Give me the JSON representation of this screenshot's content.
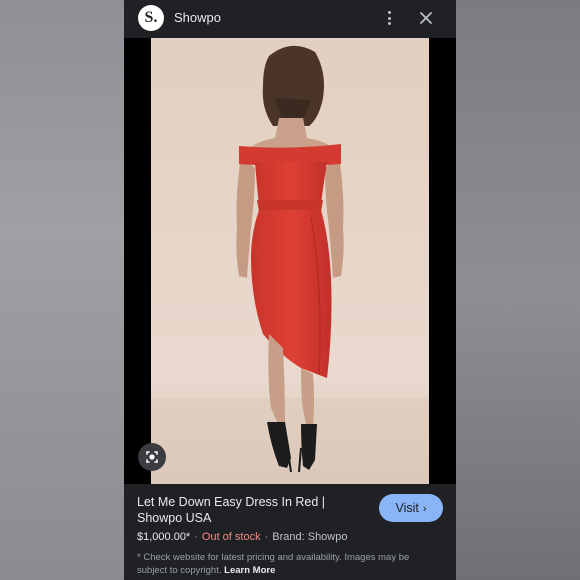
{
  "header": {
    "logo_letter": "S.",
    "site_name": "Showpo"
  },
  "image": {
    "alt": "Let Me Down Easy Dress In Red",
    "dress_color": "#d63a2f",
    "background_color": "#e6d4c7"
  },
  "product": {
    "title": "Let Me Down Easy Dress In Red | Showpo USA",
    "price": "$1,000.00*",
    "stock_status": "Out of stock",
    "brand": "Brand: Showpo",
    "separator": "·"
  },
  "actions": {
    "visit_label": "Visit",
    "visit_chevron": "›"
  },
  "disclaimer": {
    "text": "* Check website for latest pricing and availability. Images may be subject to copyright.",
    "learn_more": "Learn More"
  },
  "colors": {
    "accent": "#8ab4f8",
    "out_of_stock": "#f28b82",
    "panel_bg": "#202124"
  }
}
